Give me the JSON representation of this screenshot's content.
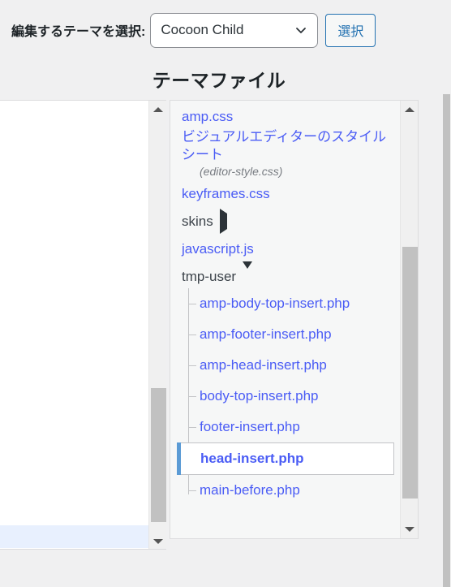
{
  "header": {
    "selector_label": "編集するテーマを選択:",
    "selected_theme": "Cocoon Child",
    "select_button_label": "選択",
    "chevron_icon": "chevron-down-icon"
  },
  "page_title": "テーマファイル",
  "file_tree": {
    "items": [
      {
        "id": "amp-css",
        "label": "amp.css",
        "type": "file"
      },
      {
        "id": "editor-style",
        "label": "ビジュアルエディターのスタイルシート",
        "note": "(editor-style.css)",
        "type": "file"
      },
      {
        "id": "keyframes-css",
        "label": "keyframes.css",
        "type": "file"
      },
      {
        "id": "skins",
        "label": "skins",
        "type": "folder-collapsed",
        "marker": "triangle-right-icon"
      },
      {
        "id": "javascript-js",
        "label": "javascript.js",
        "type": "file"
      },
      {
        "id": "tmp-user",
        "label": "tmp-user",
        "type": "folder-expanded",
        "marker": "triangle-down-icon",
        "children": [
          {
            "id": "amp-body-top-insert",
            "label": "amp-body-top-insert.php",
            "selected": false
          },
          {
            "id": "amp-footer-insert",
            "label": "amp-footer-insert.php",
            "selected": false
          },
          {
            "id": "amp-head-insert",
            "label": "amp-head-insert.php",
            "selected": false
          },
          {
            "id": "body-top-insert",
            "label": "body-top-insert.php",
            "selected": false
          },
          {
            "id": "footer-insert",
            "label": "footer-insert.php",
            "selected": false
          },
          {
            "id": "head-insert",
            "label": "head-insert.php",
            "selected": true
          },
          {
            "id": "main-before",
            "label": "main-before.php",
            "selected": false
          }
        ]
      }
    ]
  },
  "scrollbars": {
    "up_arrow_icon": "triangle-up-icon",
    "down_arrow_icon": "triangle-down-icon"
  },
  "colors": {
    "link_blue": "#4a5cf5",
    "accent_blue": "#5b9bd5",
    "button_blue": "#2271b1",
    "page_bg": "#f0f0f1",
    "panel_bg": "#f6f7f7",
    "active_line": "#e8f0fe"
  }
}
